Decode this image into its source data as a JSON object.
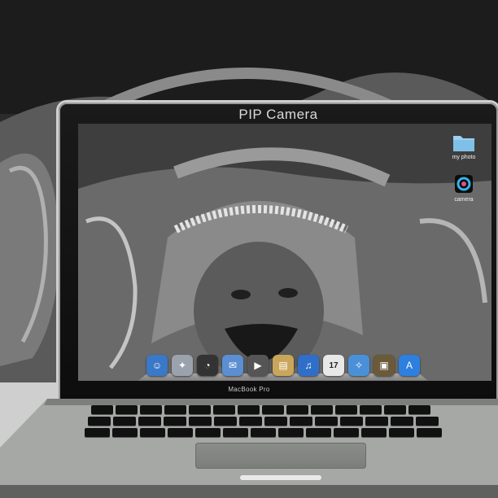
{
  "app": {
    "title": "PIP Camera"
  },
  "laptop": {
    "model_label": "MacBook Pro"
  },
  "desktop": {
    "icons": [
      {
        "label": "my photo",
        "icon": "folder-icon"
      },
      {
        "label": "camera",
        "icon": "camera-app-icon"
      }
    ]
  },
  "dock": {
    "apps": [
      {
        "name": "finder",
        "icon": "finder-icon",
        "color": "#3a78c8",
        "glyph": "☺"
      },
      {
        "name": "launchpad",
        "icon": "rocket-icon",
        "color": "#9aa3ad",
        "glyph": "✦"
      },
      {
        "name": "dashboard",
        "icon": "gauge-icon",
        "color": "#333333",
        "glyph": "◔"
      },
      {
        "name": "mail",
        "icon": "mail-icon",
        "color": "#5b8fd1",
        "glyph": "✉"
      },
      {
        "name": "facetime",
        "icon": "video-icon",
        "color": "#555555",
        "glyph": "▶"
      },
      {
        "name": "address-book",
        "icon": "book-icon",
        "color": "#c9a65a",
        "glyph": "▤"
      },
      {
        "name": "itunes",
        "icon": "music-icon",
        "color": "#2f6fc9",
        "glyph": "♫"
      },
      {
        "name": "calendar",
        "icon": "calendar-icon",
        "color": "#e8e8e8",
        "glyph": "17"
      },
      {
        "name": "safari",
        "icon": "compass-icon",
        "color": "#4a90d9",
        "glyph": "✧"
      },
      {
        "name": "iphoto",
        "icon": "photo-icon",
        "color": "#6b5a3a",
        "glyph": "▣"
      },
      {
        "name": "app-store",
        "icon": "appstore-icon",
        "color": "#2d7fe0",
        "glyph": "A"
      }
    ]
  }
}
